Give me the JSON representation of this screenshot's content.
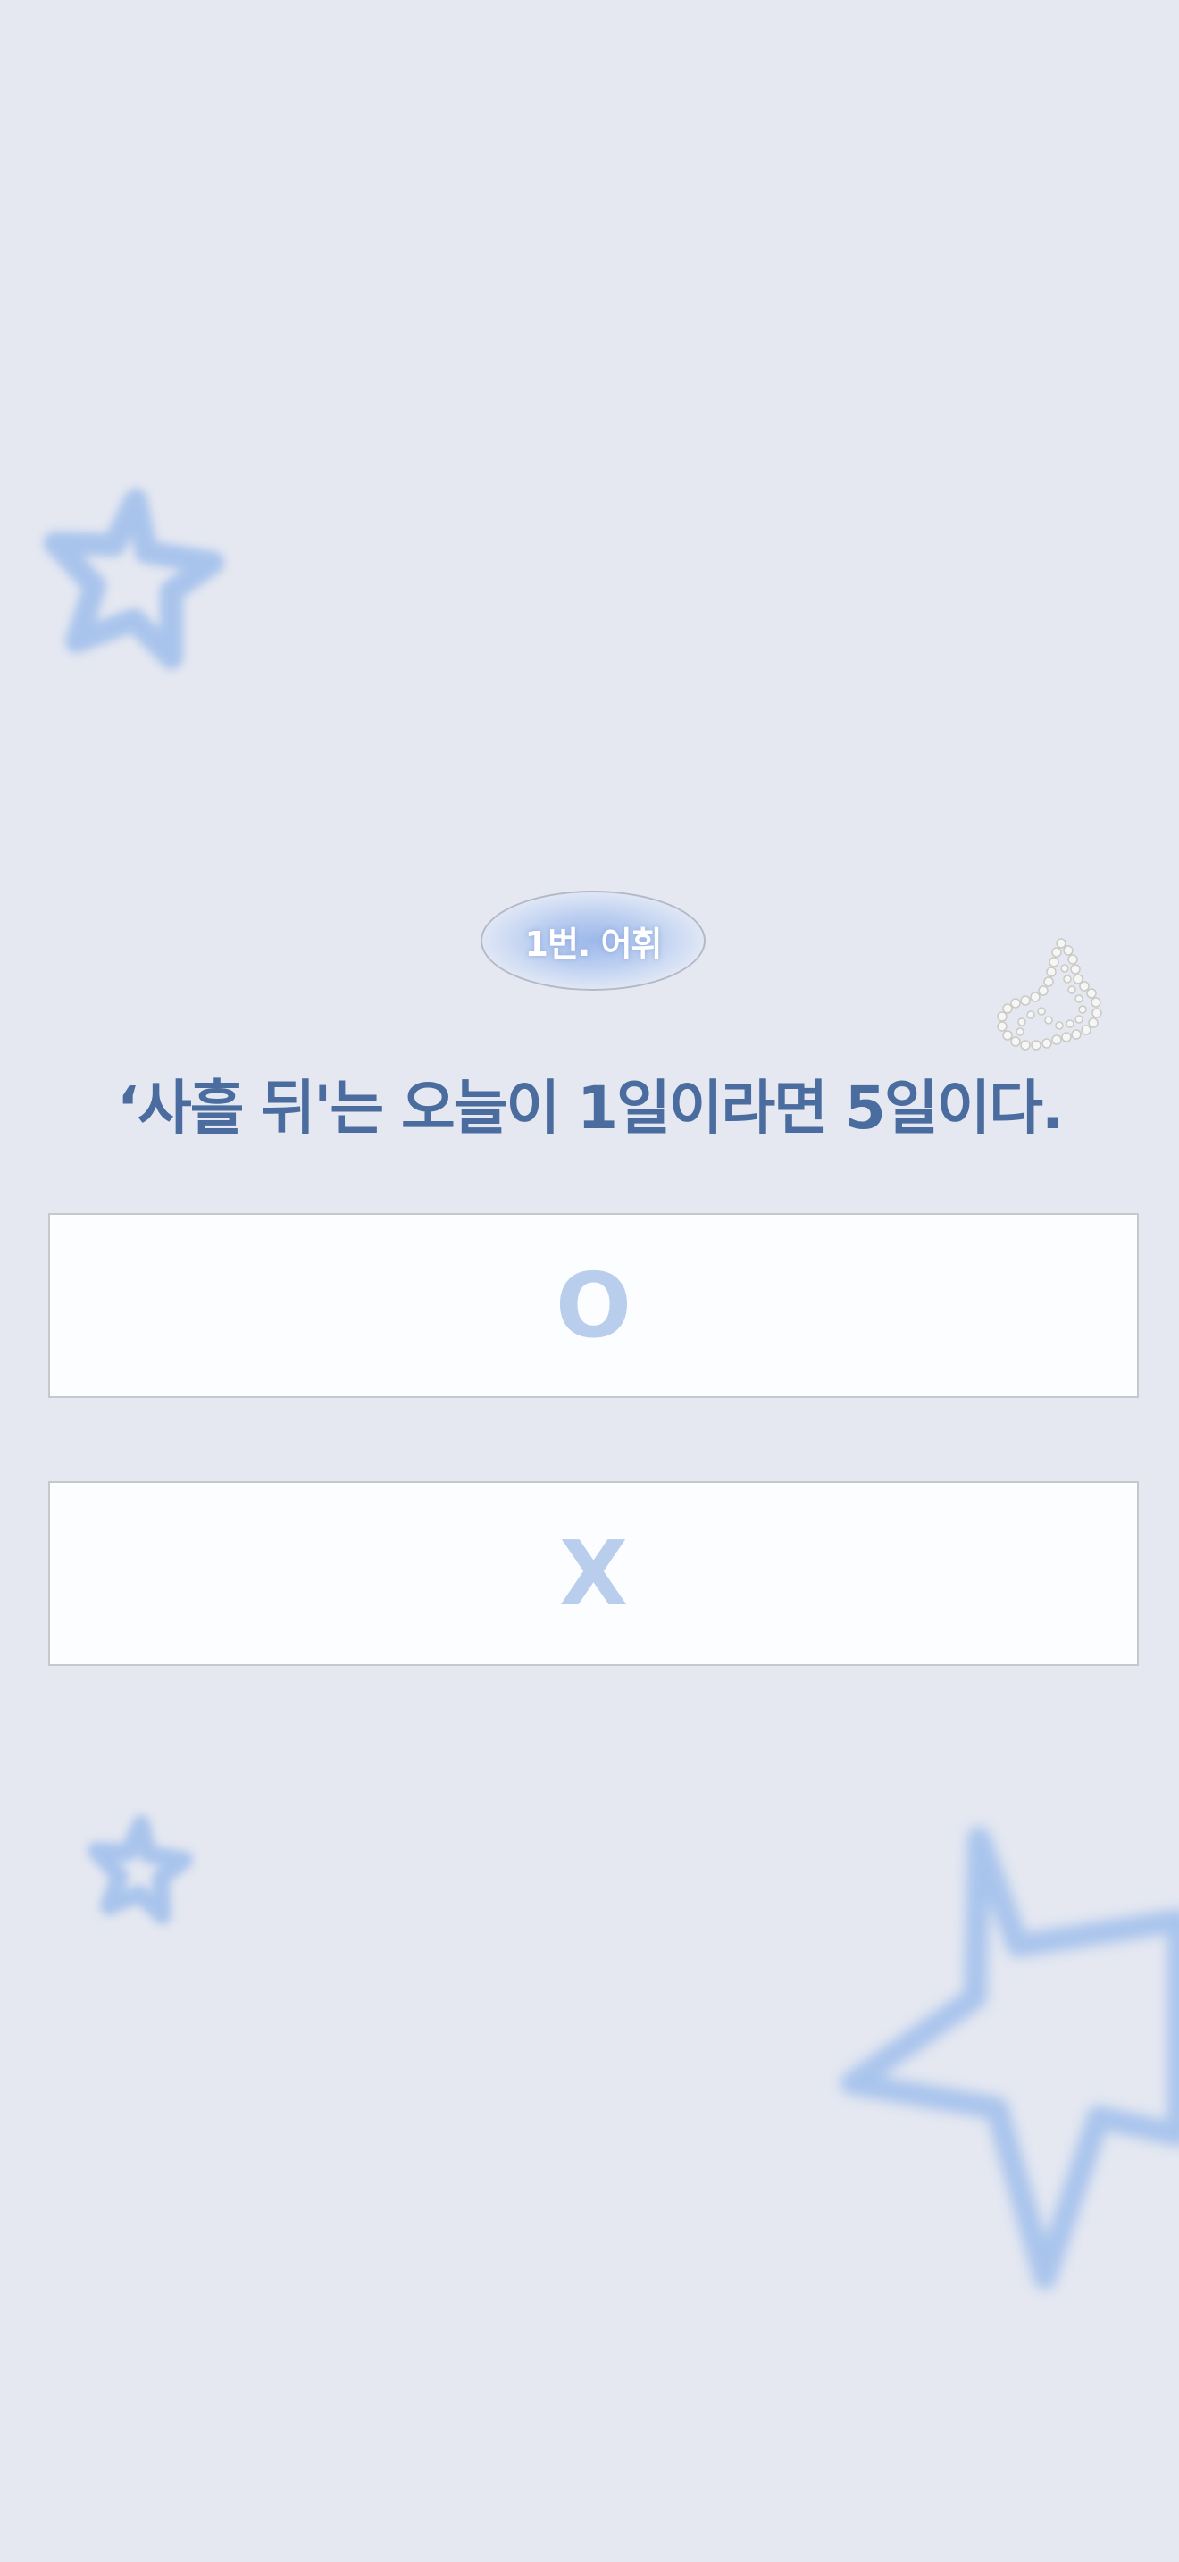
{
  "quiz": {
    "badge": "1번. 어휘",
    "question": "‘사흘 뒤'는 오늘이 1일이라면 5일이다.",
    "options": [
      {
        "label": "O"
      },
      {
        "label": "X"
      }
    ]
  },
  "colors": {
    "background": "#e5e8f1",
    "question_text": "#4a6c9f",
    "option_text": "#b9cdec",
    "star": "#a9c4ec"
  },
  "decorations": [
    "star-icon",
    "star-icon",
    "star-icon",
    "angel-wing-icon"
  ]
}
